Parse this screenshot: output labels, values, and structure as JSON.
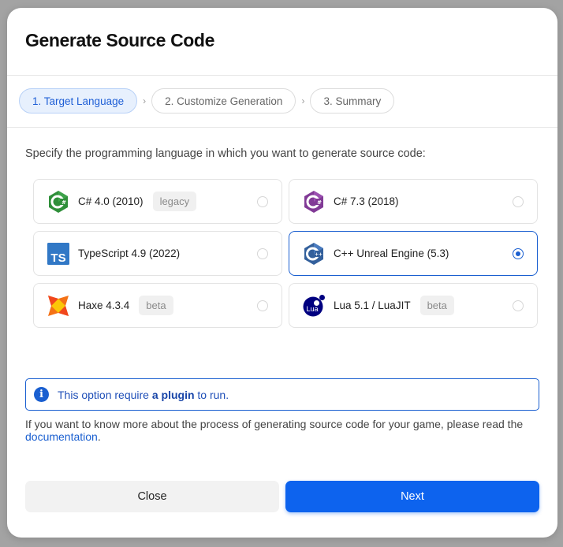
{
  "dialog": {
    "title": "Generate Source Code"
  },
  "steps": [
    {
      "label": "1. Target Language"
    },
    {
      "label": "2. Customize Generation"
    },
    {
      "label": "3. Summary"
    }
  ],
  "step_separator": "›",
  "instruction": "Specify the programming language in which you want to generate source code:",
  "options": [
    {
      "label": "C# 4.0 (2010)",
      "tag": "legacy",
      "icon": "csharp-green-icon",
      "selected": false
    },
    {
      "label": "C# 7.3 (2018)",
      "tag": "",
      "icon": "csharp-purple-icon",
      "selected": false
    },
    {
      "label": "TypeScript 4.9 (2022)",
      "tag": "",
      "icon": "typescript-icon",
      "icon_text": "TS",
      "selected": false
    },
    {
      "label": "C++ Unreal Engine (5.3)",
      "tag": "",
      "icon": "cplusplus-icon",
      "selected": true
    },
    {
      "label": "Haxe 4.3.4",
      "tag": "beta",
      "icon": "haxe-icon",
      "selected": false
    },
    {
      "label": "Lua 5.1 / LuaJIT",
      "tag": "beta",
      "icon": "lua-icon",
      "icon_text": "Lua",
      "selected": false
    }
  ],
  "info": {
    "text_before": "This option require ",
    "link": "a plugin",
    "text_after": " to run.",
    "icon_glyph": "i"
  },
  "help": {
    "text": "If you want to know more about the process of generating source code for your game, please read the",
    "link": "documentation",
    "suffix": "."
  },
  "buttons": {
    "close": "Close",
    "next": "Next"
  },
  "colors": {
    "accent": "#0d63ee",
    "csharp_green": "#2f8f3a",
    "csharp_purple": "#813a96",
    "typescript": "#3178c6",
    "cplusplus": "#33609c",
    "haxe": "#f47216",
    "lua": "#000080"
  }
}
